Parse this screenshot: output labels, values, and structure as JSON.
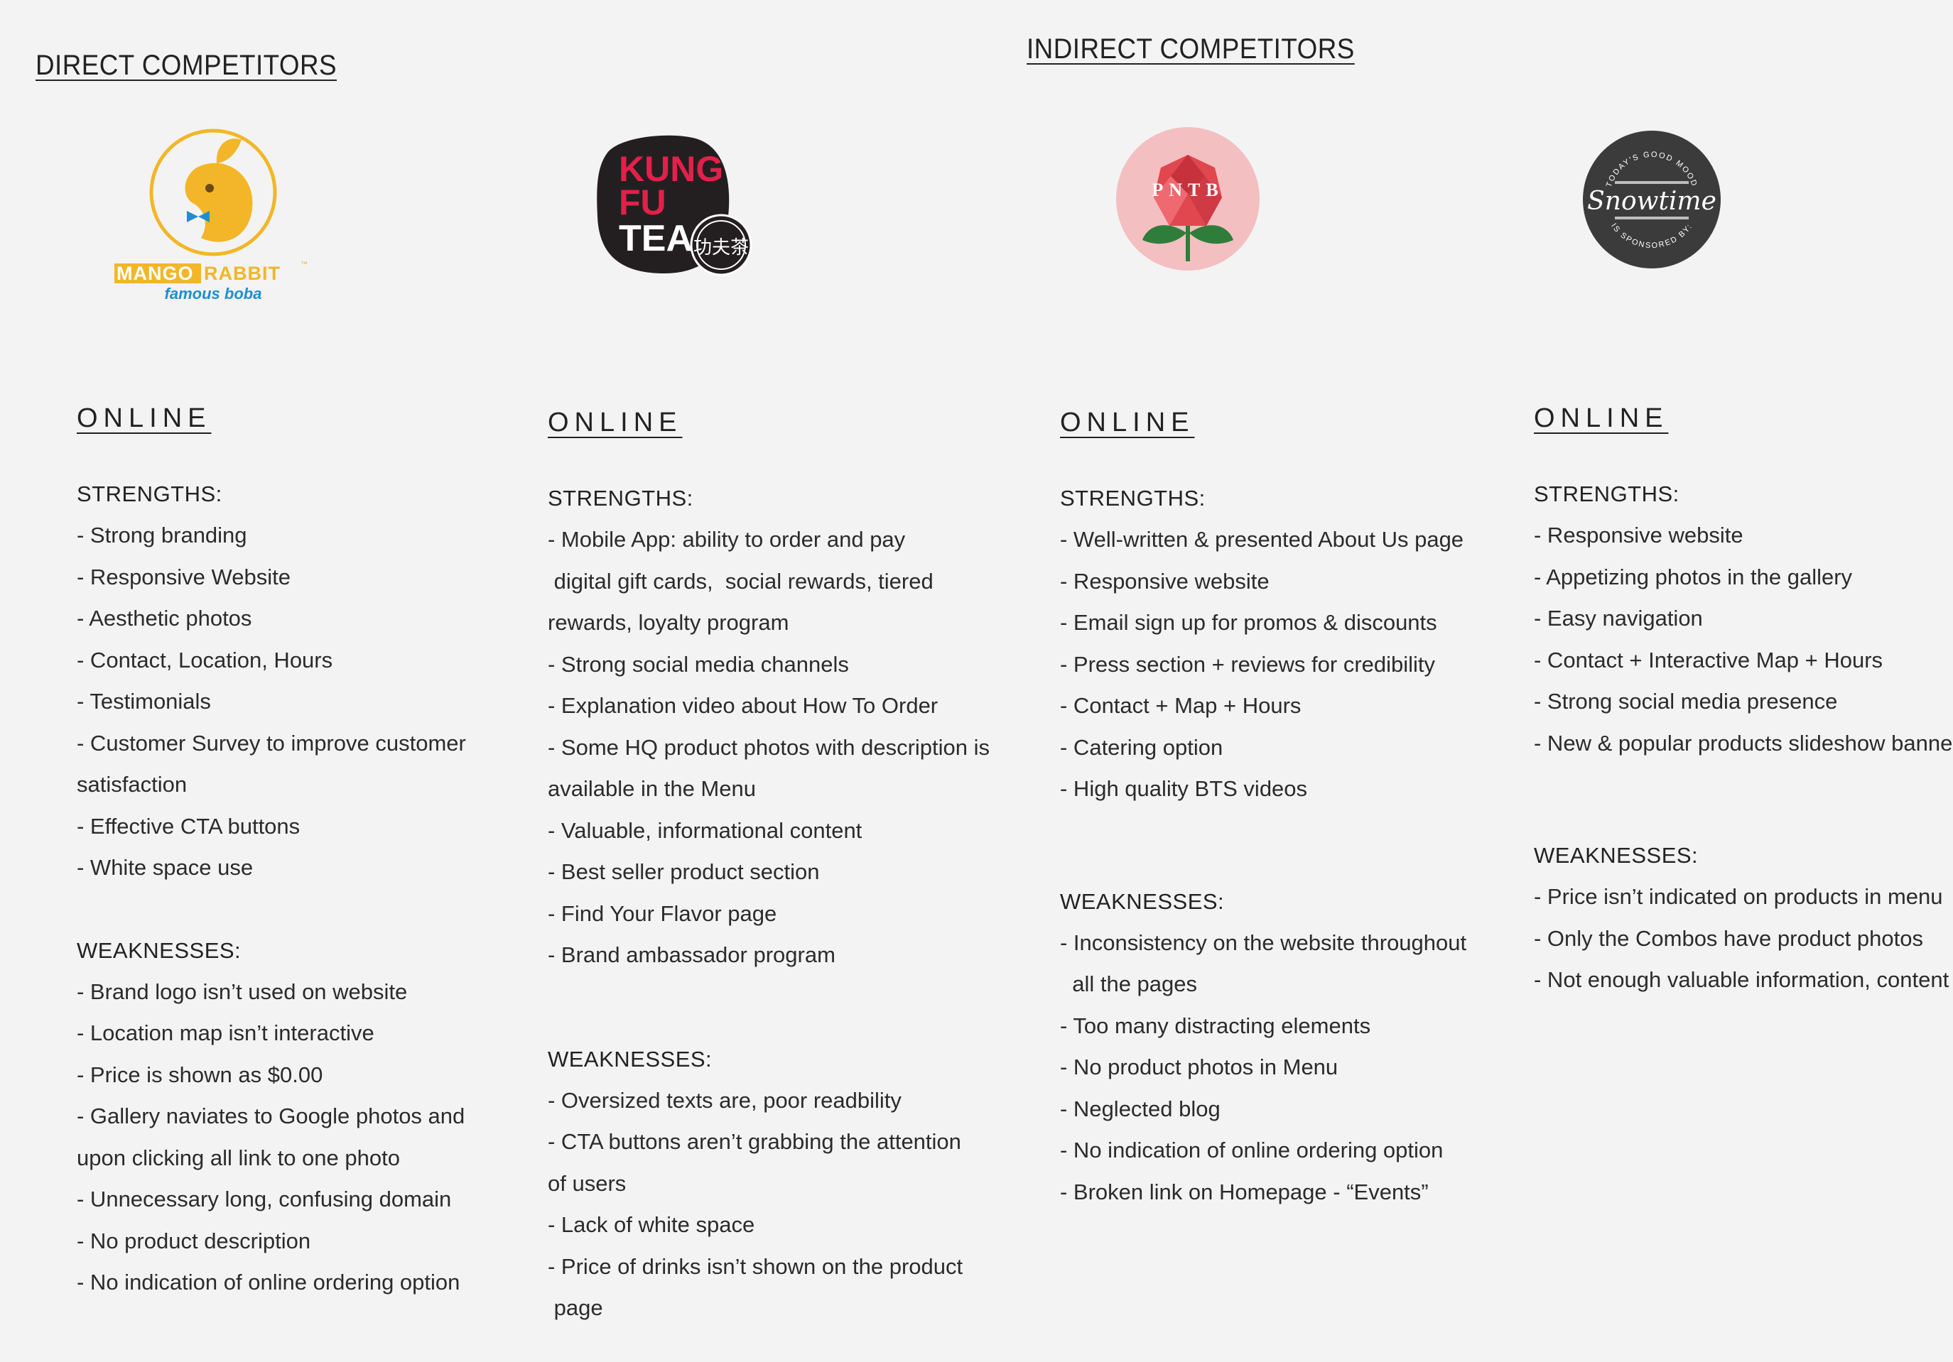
{
  "headings": {
    "direct": "DIRECT COMPETITORS",
    "indirect": "INDIRECT COMPETITORS"
  },
  "logos": {
    "mango_rabbit": {
      "brand": "MANGO RABBIT",
      "word1": "MANGO",
      "word2": "RABBIT",
      "tm": "™",
      "tagline": "famous boba"
    },
    "kung_fu_tea": {
      "line1": "KUNG",
      "line2": "FU",
      "line3": "TEA",
      "chinese": "功夫茶"
    },
    "pntb": {
      "text": "PNTB"
    },
    "snowtime": {
      "top": "TODAY'S GOOD MOOD",
      "name": "Snowtime",
      "bottom": "IS SPONSORED BY:"
    }
  },
  "colors": {
    "background": "#f3f3f3",
    "text": "#2b2b2b",
    "mango_yellow": "#f2b628",
    "mango_blue": "#1d8fd0",
    "kft_red": "#e3204a",
    "kft_black": "#231f20",
    "pntb_pink": "#f4bfc1",
    "pntb_red": "#e0474f",
    "snowtime_gray": "#3b3b3b"
  },
  "columns": [
    {
      "online": "ONLINE",
      "strengths_title": "STRENGTHS:",
      "strengths": [
        "- Strong branding",
        "- Responsive Website",
        "- Aesthetic photos",
        "- Contact, Location, Hours",
        "- Testimonials",
        "- Customer Survey to improve customer",
        "satisfaction",
        "- Effective CTA buttons",
        "- White space use"
      ],
      "weaknesses_title": "WEAKNESSES:",
      "weaknesses": [
        "- Brand logo isn’t used on website",
        "- Location map isn’t interactive",
        "- Price is shown as $0.00",
        "- Gallery naviates to Google photos and",
        "upon clicking all link to one photo",
        "- Unnecessary long, confusing domain",
        "- No product description",
        "- No indication of online ordering option"
      ]
    },
    {
      "online": "ONLINE",
      "strengths_title": "STRENGTHS:",
      "strengths": [
        "- Mobile App:  ability to order and pay",
        " digital gift cards,  social rewards, tiered",
        "rewards, loyalty program",
        "- Strong social media channels",
        "- Explanation video about How To Order",
        "- Some HQ product photos with description is",
        "available in the Menu",
        "- Valuable, informational content",
        "- Best seller product section",
        "- Find Your Flavor page",
        "- Brand ambassador program"
      ],
      "weaknesses_title": "WEAKNESSES:",
      "weaknesses": [
        "- Oversized texts are, poor readbility",
        "- CTA buttons aren’t grabbing the attention",
        "of users",
        "- Lack of white space",
        "- Price of drinks isn’t shown on the product",
        " page"
      ]
    },
    {
      "online": "ONLINE",
      "strengths_title": "STRENGTHS:",
      "strengths": [
        "- Well-written & presented About Us page",
        "- Responsive website",
        "- Email sign up for promos & discounts",
        "- Press section + reviews for credibility",
        "- Contact + Map + Hours",
        "- Catering option",
        "- High quality BTS videos"
      ],
      "weaknesses_title": "WEAKNESSES:",
      "weaknesses": [
        "- Inconsistency on the website throughout",
        "  all the pages",
        "- Too many distracting elements",
        "- No product photos in Menu",
        "- Neglected blog",
        "- No indication of online ordering option",
        "- Broken link on Homepage - “Events”"
      ]
    },
    {
      "online": "ONLINE",
      "strengths_title": "STRENGTHS:",
      "strengths": [
        "- Responsive website",
        "- Appetizing photos in the gallery",
        "- Easy navigation",
        "- Contact + Interactive Map + Hours",
        "- Strong social media presence",
        "- New & popular products slideshow banner"
      ],
      "weaknesses_title": "WEAKNESSES:",
      "weaknesses": [
        "- Price isn’t indicated on products in menu",
        "- Only the Combos have product photos",
        "- Not enough valuable information, content"
      ]
    }
  ]
}
